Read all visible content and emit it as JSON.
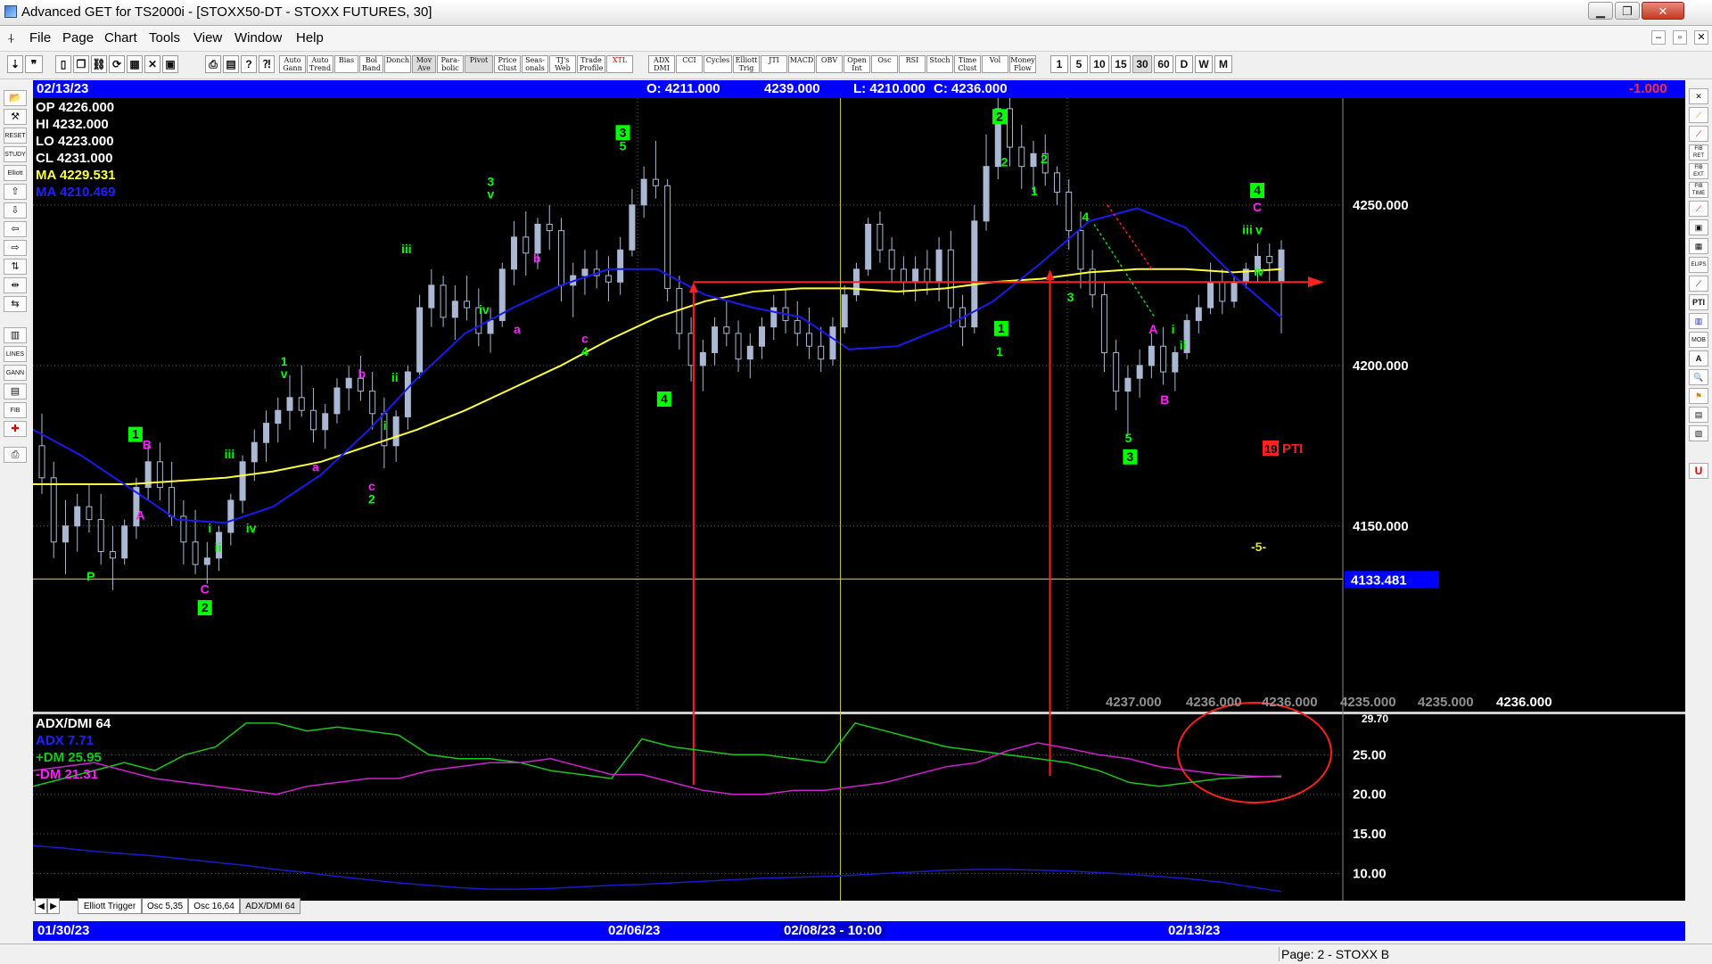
{
  "window": {
    "title": "Advanced GET for TS2000i - [STOXX50-DT - STOXX FUTURES, 30]",
    "controls": [
      "▁",
      "❐",
      "✕"
    ],
    "mdi_controls": [
      "‒",
      "▫",
      "✕"
    ]
  },
  "menu": [
    "File",
    "Page",
    "Chart",
    "Tools",
    "View",
    "Window",
    "Help"
  ],
  "toolbar": {
    "studies": [
      "Auto Gann",
      "Auto Trend",
      "Bias",
      "Bol Band",
      "Donch",
      "Mov Ave",
      "Para-bolic",
      "Pivot",
      "Price Clust",
      "Seas-onals",
      "TJ's Web",
      "Trade Profile",
      "XTL",
      "ADX DMI",
      "CCI",
      "Cycles",
      "Elliott Trig",
      "JTI",
      "MACD",
      "OBV",
      "Open Int",
      "Osc",
      "RSI",
      "Stoch",
      "Time Clust",
      "Vol",
      "Money Flow"
    ],
    "intervals": [
      "1",
      "5",
      "10",
      "15",
      "30",
      "60",
      "D",
      "W",
      "M"
    ],
    "active_interval": "30"
  },
  "left_tools": [
    "📂",
    "⚒",
    "RESET",
    "STUDY",
    "Elliott",
    "⇧",
    "⇩",
    "⇦",
    "⇨",
    "⇅",
    "⇹",
    "⇆",
    "▥",
    "LINES",
    "GANN",
    "▤",
    "FIB",
    "✚",
    "⎙"
  ],
  "right_tools": [
    "✕",
    "⟋",
    "⟋",
    "FIB RET",
    "FIB EXT",
    "FIB TIME",
    "⟋",
    "▣",
    "▦",
    "ELIPS",
    "⟋",
    "PTI",
    "▥",
    "MOB",
    "A",
    "🔍",
    "⚑",
    "▤",
    "▧",
    "U"
  ],
  "header": {
    "date": "02/13/23",
    "open": "O: 4211.000",
    "high": "4239.000",
    "low": "L: 4210.000",
    "close": "C: 4236.000",
    "change": "-1.000"
  },
  "footer_dates": [
    "01/30/23",
    "02/06/23",
    "02/08/23 - 10:00",
    "02/13/23"
  ],
  "tabs": [
    "Elliott Trigger",
    "Osc 5,35",
    "Osc 16,64",
    "ADX/DMI 64"
  ],
  "status": "Page: 2 - STOXX B",
  "colors": {
    "bg": "#000000",
    "up_candle": "#aab8d4",
    "ma1": "#ffff40",
    "ma2": "#1a1aee",
    "plus_dm": "#18c818",
    "minus_dm": "#d020d0",
    "adx": "#1a1acc",
    "annot_red": "#ff2020",
    "wave_green": "#00ff00",
    "wave_magenta": "#ff20ff"
  },
  "chart_data": {
    "type": "candlestick",
    "symbol": "STOXX50-DT - STOXX FUTURES",
    "interval": "30",
    "price_axis": {
      "ylim": [
        4091.6,
        4283.3
      ],
      "ticks": [
        "4250.000",
        "4200.000",
        "4150.000"
      ],
      "tick_values": [
        4250,
        4200,
        4150
      ],
      "hline_value": 4133.481,
      "hline_label": "4133.481",
      "red_hline_value": 4226
    },
    "x_dates": [
      "01/30/23",
      "02/06/23",
      "02/08/23 - 10:00",
      "02/13/23"
    ],
    "legend": [
      {
        "label": "OP  4226.000",
        "color": "#ffffff"
      },
      {
        "label": "HI   4232.000",
        "color": "#ffffff"
      },
      {
        "label": "LO   4223.000",
        "color": "#ffffff"
      },
      {
        "label": "CL   4231.000",
        "color": "#ffffff"
      },
      {
        "label": "MA  4229.531",
        "color": "#ffff40"
      },
      {
        "label": "MA  4210.469",
        "color": "#2020ff"
      }
    ],
    "bottom_values": [
      "4237.000",
      "4236.000",
      "4236.000",
      "4235.000",
      "4235.000",
      "4236.000"
    ],
    "candles": [
      [
        4175,
        4185,
        4160,
        4165
      ],
      [
        4165,
        4170,
        4140,
        4145
      ],
      [
        4145,
        4158,
        4135,
        4150
      ],
      [
        4150,
        4160,
        4142,
        4156
      ],
      [
        4156,
        4163,
        4148,
        4152
      ],
      [
        4152,
        4160,
        4138,
        4142
      ],
      [
        4142,
        4150,
        4130,
        4140
      ],
      [
        4140,
        4152,
        4138,
        4150
      ],
      [
        4150,
        4165,
        4146,
        4162
      ],
      [
        4162,
        4175,
        4158,
        4170
      ],
      [
        4170,
        4176,
        4158,
        4162
      ],
      [
        4162,
        4170,
        4150,
        4153
      ],
      [
        4153,
        4158,
        4138,
        4145
      ],
      [
        4145,
        4155,
        4135,
        4138
      ],
      [
        4138,
        4145,
        4132,
        4140
      ],
      [
        4140,
        4150,
        4136,
        4148
      ],
      [
        4148,
        4160,
        4144,
        4158
      ],
      [
        4158,
        4172,
        4154,
        4170
      ],
      [
        4170,
        4180,
        4164,
        4176
      ],
      [
        4176,
        4186,
        4170,
        4182
      ],
      [
        4182,
        4190,
        4176,
        4186
      ],
      [
        4186,
        4197,
        4180,
        4190
      ],
      [
        4190,
        4200,
        4184,
        4186
      ],
      [
        4186,
        4193,
        4176,
        4180
      ],
      [
        4180,
        4188,
        4174,
        4185
      ],
      [
        4185,
        4196,
        4182,
        4193
      ],
      [
        4193,
        4200,
        4186,
        4196
      ],
      [
        4196,
        4203,
        4189,
        4192
      ],
      [
        4192,
        4198,
        4180,
        4185
      ],
      [
        4185,
        4190,
        4168,
        4175
      ],
      [
        4175,
        4186,
        4170,
        4184
      ],
      [
        4184,
        4200,
        4180,
        4198
      ],
      [
        4198,
        4222,
        4196,
        4218
      ],
      [
        4218,
        4230,
        4212,
        4225
      ],
      [
        4225,
        4228,
        4212,
        4215
      ],
      [
        4215,
        4225,
        4208,
        4220
      ],
      [
        4220,
        4228,
        4214,
        4218
      ],
      [
        4218,
        4224,
        4206,
        4210
      ],
      [
        4210,
        4218,
        4204,
        4214
      ],
      [
        4214,
        4232,
        4212,
        4230
      ],
      [
        4230,
        4245,
        4225,
        4240
      ],
      [
        4240,
        4248,
        4228,
        4235
      ],
      [
        4235,
        4246,
        4230,
        4244
      ],
      [
        4244,
        4250,
        4236,
        4242
      ],
      [
        4242,
        4246,
        4220,
        4225
      ],
      [
        4225,
        4232,
        4215,
        4228
      ],
      [
        4228,
        4236,
        4222,
        4230
      ],
      [
        4230,
        4236,
        4224,
        4228
      ],
      [
        4228,
        4234,
        4220,
        4226
      ],
      [
        4226,
        4240,
        4222,
        4236
      ],
      [
        4236,
        4255,
        4234,
        4250
      ],
      [
        4250,
        4262,
        4246,
        4258
      ],
      [
        4258,
        4270,
        4252,
        4256
      ],
      [
        4256,
        4258,
        4220,
        4224
      ],
      [
        4224,
        4228,
        4205,
        4210
      ],
      [
        4210,
        4215,
        4195,
        4200
      ],
      [
        4200,
        4208,
        4192,
        4204
      ],
      [
        4204,
        4215,
        4200,
        4212
      ],
      [
        4212,
        4220,
        4206,
        4210
      ],
      [
        4210,
        4214,
        4198,
        4202
      ],
      [
        4202,
        4210,
        4196,
        4206
      ],
      [
        4206,
        4215,
        4202,
        4212
      ],
      [
        4212,
        4222,
        4208,
        4218
      ],
      [
        4218,
        4224,
        4210,
        4214
      ],
      [
        4214,
        4220,
        4206,
        4210
      ],
      [
        4210,
        4218,
        4202,
        4206
      ],
      [
        4206,
        4212,
        4198,
        4202
      ],
      [
        4202,
        4215,
        4200,
        4212
      ],
      [
        4212,
        4225,
        4210,
        4222
      ],
      [
        4222,
        4232,
        4220,
        4230
      ],
      [
        4230,
        4246,
        4228,
        4244
      ],
      [
        4244,
        4248,
        4232,
        4236
      ],
      [
        4236,
        4240,
        4226,
        4230
      ],
      [
        4230,
        4234,
        4222,
        4226
      ],
      [
        4226,
        4234,
        4220,
        4230
      ],
      [
        4230,
        4236,
        4222,
        4226
      ],
      [
        4226,
        4240,
        4220,
        4236
      ],
      [
        4236,
        4242,
        4212,
        4218
      ],
      [
        4218,
        4222,
        4206,
        4212
      ],
      [
        4212,
        4250,
        4210,
        4245
      ],
      [
        4245,
        4272,
        4242,
        4262
      ],
      [
        4262,
        4284,
        4258,
        4280
      ],
      [
        4280,
        4284,
        4262,
        4268
      ],
      [
        4268,
        4275,
        4255,
        4262
      ],
      [
        4262,
        4270,
        4254,
        4266
      ],
      [
        4266,
        4272,
        4256,
        4260
      ],
      [
        4260,
        4262,
        4250,
        4254
      ],
      [
        4254,
        4258,
        4236,
        4242
      ],
      [
        4242,
        4248,
        4224,
        4230
      ],
      [
        4230,
        4236,
        4218,
        4222
      ],
      [
        4222,
        4226,
        4198,
        4204
      ],
      [
        4204,
        4208,
        4186,
        4192
      ],
      [
        4192,
        4200,
        4178,
        4196
      ],
      [
        4196,
        4205,
        4190,
        4200
      ],
      [
        4200,
        4210,
        4196,
        4206
      ],
      [
        4206,
        4212,
        4194,
        4198
      ],
      [
        4198,
        4206,
        4192,
        4204
      ],
      [
        4204,
        4216,
        4202,
        4214
      ],
      [
        4214,
        4222,
        4210,
        4218
      ],
      [
        4218,
        4232,
        4216,
        4226
      ],
      [
        4226,
        4230,
        4216,
        4220
      ],
      [
        4220,
        4228,
        4218,
        4226
      ],
      [
        4226,
        4232,
        4224,
        4230
      ],
      [
        4230,
        4238,
        4226,
        4234
      ],
      [
        4234,
        4238,
        4226,
        4232
      ],
      [
        4226,
        4239,
        4210,
        4236
      ]
    ],
    "ma1": {
      "name": "MA",
      "values": [
        4163,
        4163,
        4163,
        4164,
        4165,
        4167,
        4170,
        4175,
        4180,
        4186,
        4193,
        4200,
        4208,
        4215,
        4220,
        4223,
        4224,
        4224,
        4223,
        4224,
        4226,
        4227,
        4229,
        4230,
        4230,
        4229,
        4230
      ]
    },
    "ma2": {
      "name": "MA",
      "values": [
        4180,
        4172,
        4162,
        4152,
        4151,
        4156,
        4166,
        4180,
        4196,
        4210,
        4218,
        4225,
        4230,
        4230,
        4222,
        4218,
        4215,
        4205,
        4206,
        4212,
        4220,
        4232,
        4245,
        4249,
        4243,
        4228,
        4215
      ]
    },
    "wave_labels": [
      {
        "text": "P",
        "color": "green",
        "x": 0.035,
        "v": 4133
      },
      {
        "text": "1",
        "color": "greenbox",
        "x": 0.062,
        "v": 4177
      },
      {
        "text": "B",
        "color": "magenta",
        "x": 0.069,
        "v": 4174
      },
      {
        "text": "A",
        "color": "magenta",
        "x": 0.065,
        "v": 4152
      },
      {
        "text": "C",
        "color": "magenta",
        "x": 0.104,
        "v": 4129
      },
      {
        "text": "2",
        "color": "greenbox",
        "x": 0.104,
        "v": 4123
      },
      {
        "text": "i",
        "color": "green",
        "x": 0.107,
        "v": 4148
      },
      {
        "text": "ii",
        "color": "green",
        "x": 0.112,
        "v": 4142
      },
      {
        "text": "iii",
        "color": "green",
        "x": 0.119,
        "v": 4171
      },
      {
        "text": "iv",
        "color": "green",
        "x": 0.132,
        "v": 4148
      },
      {
        "text": "a",
        "color": "magenta",
        "x": 0.171,
        "v": 4167
      },
      {
        "text": "1",
        "color": "green",
        "x": 0.152,
        "v": 4200
      },
      {
        "text": "v",
        "color": "green",
        "x": 0.152,
        "v": 4196
      },
      {
        "text": "b",
        "color": "magenta",
        "x": 0.199,
        "v": 4196
      },
      {
        "text": "c",
        "color": "magenta",
        "x": 0.205,
        "v": 4161
      },
      {
        "text": "2",
        "color": "green",
        "x": 0.205,
        "v": 4157
      },
      {
        "text": "i",
        "color": "green",
        "x": 0.213,
        "v": 4180
      },
      {
        "text": "ii",
        "color": "green",
        "x": 0.219,
        "v": 4195
      },
      {
        "text": "iii",
        "color": "green",
        "x": 0.226,
        "v": 4235
      },
      {
        "text": "iv",
        "color": "green",
        "x": 0.273,
        "v": 4216
      },
      {
        "text": "3",
        "color": "green",
        "x": 0.277,
        "v": 4256
      },
      {
        "text": "v",
        "color": "green",
        "x": 0.277,
        "v": 4252
      },
      {
        "text": "a",
        "color": "magenta",
        "x": 0.293,
        "v": 4210
      },
      {
        "text": "b",
        "color": "magenta",
        "x": 0.305,
        "v": 4232
      },
      {
        "text": "c",
        "color": "magenta",
        "x": 0.334,
        "v": 4207
      },
      {
        "text": "4",
        "color": "green",
        "x": 0.334,
        "v": 4203
      },
      {
        "text": "3",
        "color": "greenbox",
        "x": 0.357,
        "v": 4271
      },
      {
        "text": "5",
        "color": "green",
        "x": 0.357,
        "v": 4267
      },
      {
        "text": "4",
        "color": "greenbox",
        "x": 0.382,
        "v": 4188
      },
      {
        "text": "2",
        "color": "greenbox",
        "x": 0.585,
        "v": 4276
      },
      {
        "text": "2",
        "color": "green",
        "x": 0.588,
        "v": 4262
      },
      {
        "text": "1",
        "color": "greenbox",
        "x": 0.586,
        "v": 4210
      },
      {
        "text": "1",
        "color": "green",
        "x": 0.585,
        "v": 4203
      },
      {
        "text": "2",
        "color": "green",
        "x": 0.612,
        "v": 4263
      },
      {
        "text": "1",
        "color": "green",
        "x": 0.606,
        "v": 4253
      },
      {
        "text": "4",
        "color": "green",
        "x": 0.637,
        "v": 4245
      },
      {
        "text": "3",
        "color": "green",
        "x": 0.628,
        "v": 4220
      },
      {
        "text": "A",
        "color": "magenta",
        "x": 0.678,
        "v": 4210
      },
      {
        "text": "B",
        "color": "magenta",
        "x": 0.685,
        "v": 4188
      },
      {
        "text": "i",
        "color": "green",
        "x": 0.69,
        "v": 4210
      },
      {
        "text": "ii",
        "color": "green",
        "x": 0.696,
        "v": 4205
      },
      {
        "text": "5",
        "color": "green",
        "x": 0.663,
        "v": 4176
      },
      {
        "text": "3",
        "color": "greenbox",
        "x": 0.664,
        "v": 4170
      },
      {
        "text": "iii",
        "color": "green",
        "x": 0.735,
        "v": 4241
      },
      {
        "text": "v",
        "color": "green",
        "x": 0.742,
        "v": 4241
      },
      {
        "text": "iv",
        "color": "green",
        "x": 0.742,
        "v": 4228
      },
      {
        "text": "4",
        "color": "greenbox",
        "x": 0.741,
        "v": 4253
      },
      {
        "text": "C",
        "color": "magenta",
        "x": 0.741,
        "v": 4248
      }
    ],
    "pti": {
      "value": "19",
      "label": "PTI"
    },
    "target_label": "-5-",
    "indicator": {
      "title": "ADX/DMI 64",
      "legend": [
        {
          "label": "ADX 7.71",
          "color": "#2020ff"
        },
        {
          "label": "+DM 25.95",
          "color": "#18c818"
        },
        {
          "label": "-DM  21.31",
          "color": "#ff20ff"
        }
      ],
      "ylim": [
        7.0,
        30.0
      ],
      "ticks": [
        "25.00",
        "20.00",
        "15.00",
        "10.00"
      ],
      "tick_values": [
        25,
        20,
        15,
        10
      ],
      "top_value": "29.70",
      "plus_dm": [
        21,
        22,
        23,
        24,
        23,
        25,
        26,
        29,
        29,
        28,
        28.5,
        28,
        27.5,
        25,
        24.5,
        24.5,
        24,
        23,
        22.5,
        22,
        27,
        26,
        25.5,
        25,
        25,
        24.5,
        24,
        29,
        28,
        27,
        26,
        25.5,
        25,
        24.5,
        24,
        23,
        21.5,
        21,
        21.5,
        22,
        22.2,
        22.3
      ],
      "minus_dm": [
        23,
        23.5,
        24,
        23,
        22,
        21.5,
        21,
        20.5,
        20,
        21,
        21.5,
        22,
        22,
        23,
        23.5,
        24,
        24,
        24.5,
        23.5,
        22.5,
        22.5,
        21.5,
        20.5,
        20,
        20,
        20.5,
        20.5,
        21,
        21.5,
        22.5,
        23.5,
        24,
        25.5,
        26.5,
        25.8,
        25,
        24.5,
        23.5,
        23,
        22.5,
        22.3,
        22.2
      ],
      "adx": [
        13.5,
        13.2,
        12.8,
        12.5,
        12.2,
        11.8,
        11.4,
        11,
        10.5,
        10.1,
        9.6,
        9.2,
        8.8,
        8.5,
        8.2,
        8,
        8,
        8.1,
        8.3,
        8.5,
        8.6,
        8.8,
        9,
        9.2,
        9.4,
        9.5,
        9.6,
        9.8,
        10,
        10.2,
        10.4,
        10.5,
        10.5,
        10.4,
        10.3,
        10.1,
        9.9,
        9.6,
        9.3,
        8.9,
        8.3,
        7.7
      ]
    }
  }
}
